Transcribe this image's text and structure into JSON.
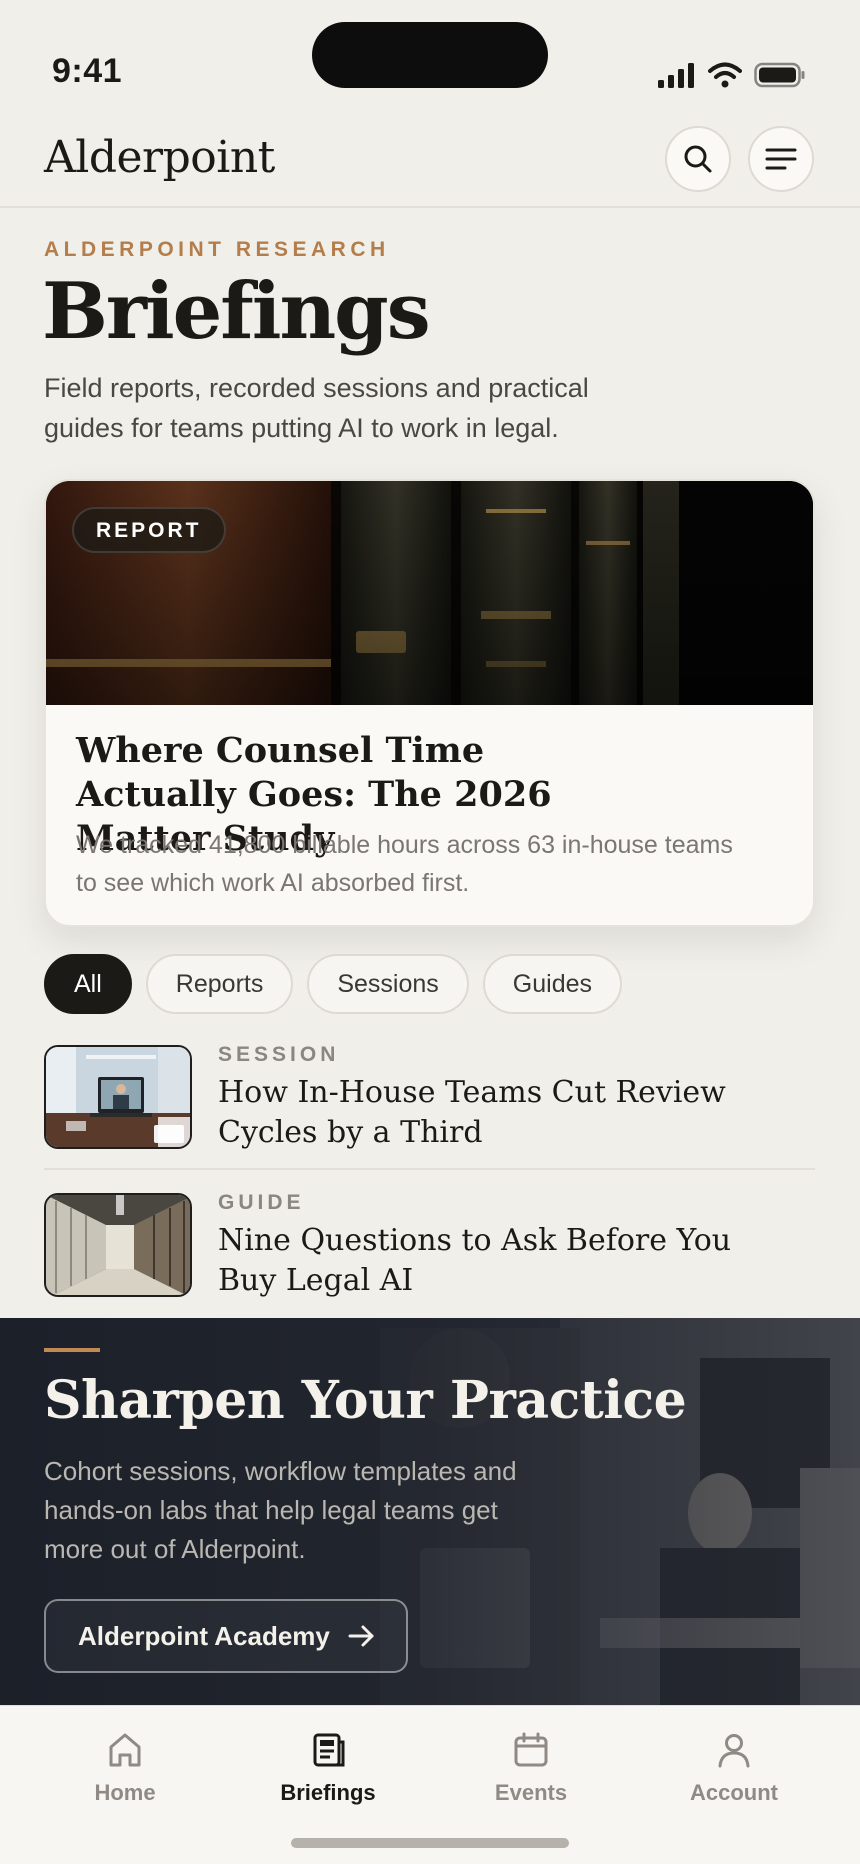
{
  "status_bar": {
    "time": "9:41"
  },
  "header": {
    "brand": "Alderpoint",
    "search_icon": "search-icon",
    "menu_icon": "menu-icon"
  },
  "intro": {
    "eyebrow": "ALDERPOINT RESEARCH",
    "title": "Briefings",
    "description": "Field reports, recorded sessions and practical guides for teams putting AI to work in legal."
  },
  "featured": {
    "badge": "REPORT",
    "title": "Where Counsel Time Actually Goes: The 2026 Matter Study",
    "description": "We tracked 41,800 billable hours across 63 in-house teams to see which work AI absorbed first."
  },
  "filters": {
    "all": "All",
    "reports": "Reports",
    "sessions": "Sessions",
    "guides": "Guides",
    "active": "All"
  },
  "list": [
    {
      "kind": "SESSION",
      "title": "How In-House Teams Cut Review Cycles by a Third"
    },
    {
      "kind": "GUIDE",
      "title": "Nine Questions to Ask Before You Buy Legal AI"
    }
  ],
  "promo": {
    "title": "Sharpen Your Practice",
    "description": "Cohort sessions, workflow templates and hands-on labs that help legal teams get more out of Alderpoint.",
    "button": "Alderpoint Academy",
    "accent": "#c08a52"
  },
  "tabs": [
    {
      "label": "Home",
      "icon": "home-icon"
    },
    {
      "label": "Briefings",
      "icon": "briefings-icon"
    },
    {
      "label": "Events",
      "icon": "calendar-icon"
    },
    {
      "label": "Account",
      "icon": "account-icon"
    }
  ],
  "active_tab": "Briefings",
  "colors": {
    "background": "#f1efea",
    "eyebrow": "#b37e4b",
    "ink": "#1b1a17",
    "promo_bg": "#1c2029"
  }
}
